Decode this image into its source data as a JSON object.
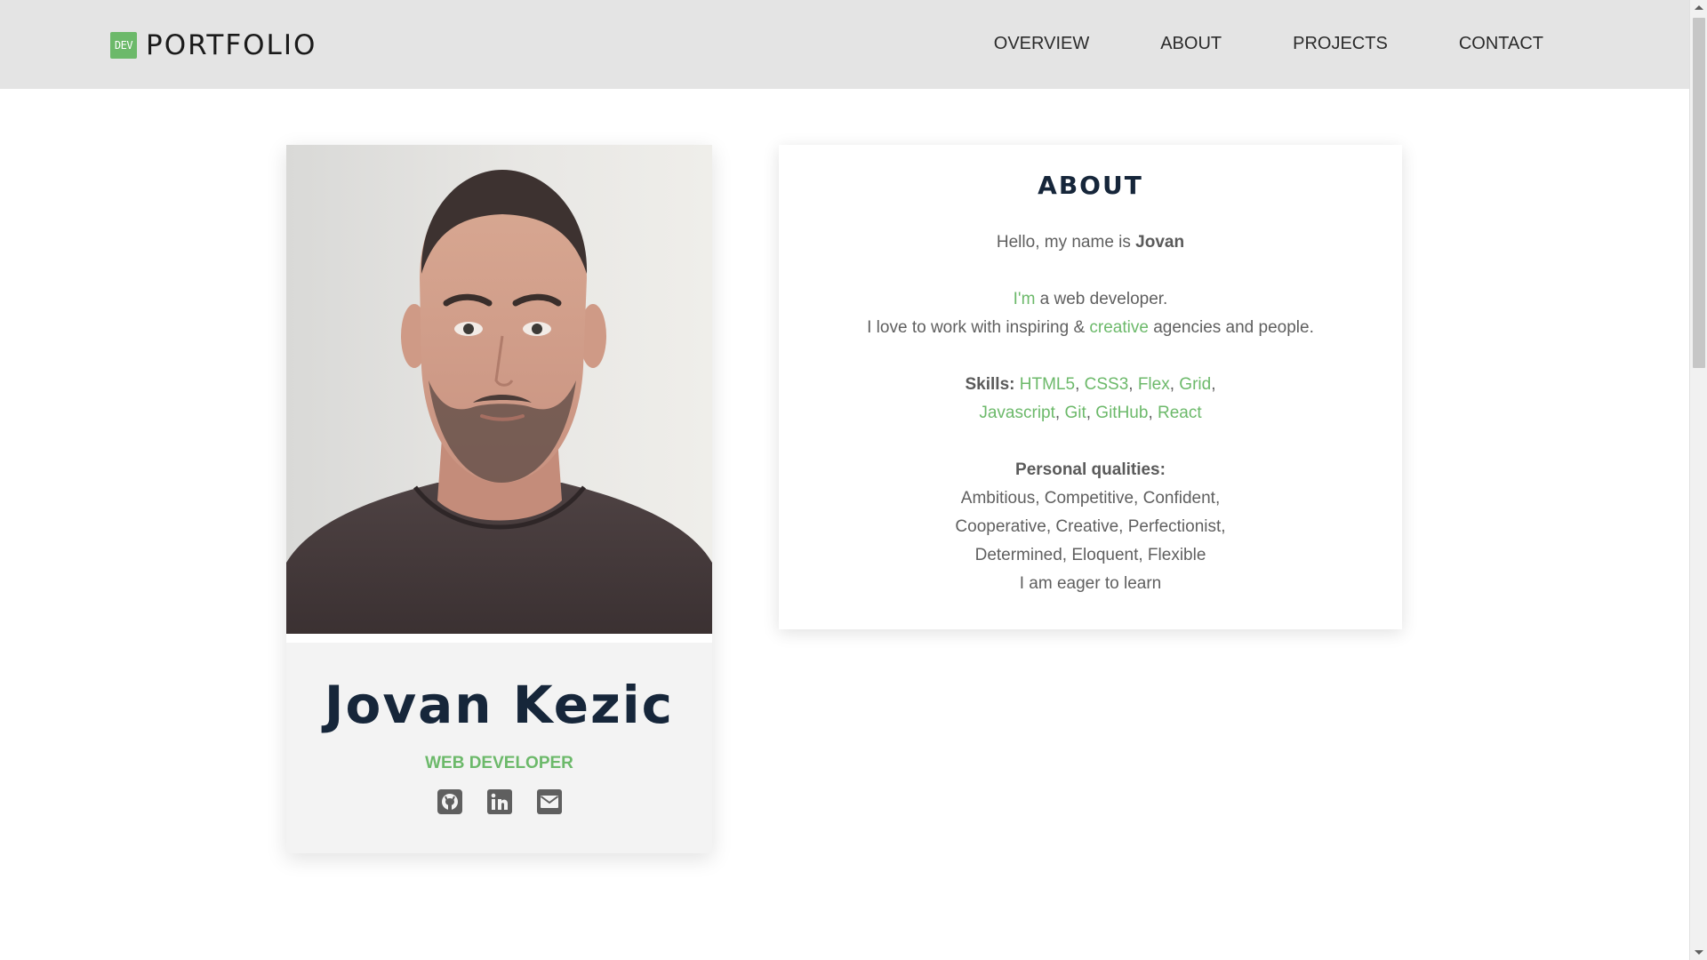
{
  "header": {
    "logo_badge": "DEV",
    "logo_text": "PORTFOLIO",
    "nav": [
      {
        "label": "OVERVIEW"
      },
      {
        "label": "ABOUT"
      },
      {
        "label": "PROJECTS"
      },
      {
        "label": "CONTACT"
      }
    ]
  },
  "profile": {
    "name": "Jovan Kezic",
    "title": "WEB DEVELOPER",
    "socials": [
      "github-icon",
      "linkedin-icon",
      "email-icon"
    ]
  },
  "about": {
    "heading": "ABOUT",
    "greeting_prefix": "Hello, my name is ",
    "greeting_name": "Jovan",
    "im": "I'm",
    "im_rest": " a web developer.",
    "love_prefix": "I love to work with inspiring & ",
    "love_creative": "creative",
    "love_suffix": " agencies and people.",
    "skills_label": "Skills:",
    "skills_line1": [
      "HTML5",
      "CSS3",
      "Flex",
      "Grid"
    ],
    "skills_line2": [
      "Javascript",
      "Git",
      "GitHub",
      "React"
    ],
    "qualities_label": "Personal qualities:",
    "qualities_line1": "Ambitious, Competitive, Confident,",
    "qualities_line2": "Cooperative, Creative, Perfectionist,",
    "qualities_line3": "Determined, Eloquent, Flexible",
    "eager": "I am eager to learn"
  },
  "colors": {
    "accent": "#6cb96a",
    "heading": "#16263a",
    "header_bg": "#e4e4e4",
    "card_bg": "#f3f3f3"
  }
}
